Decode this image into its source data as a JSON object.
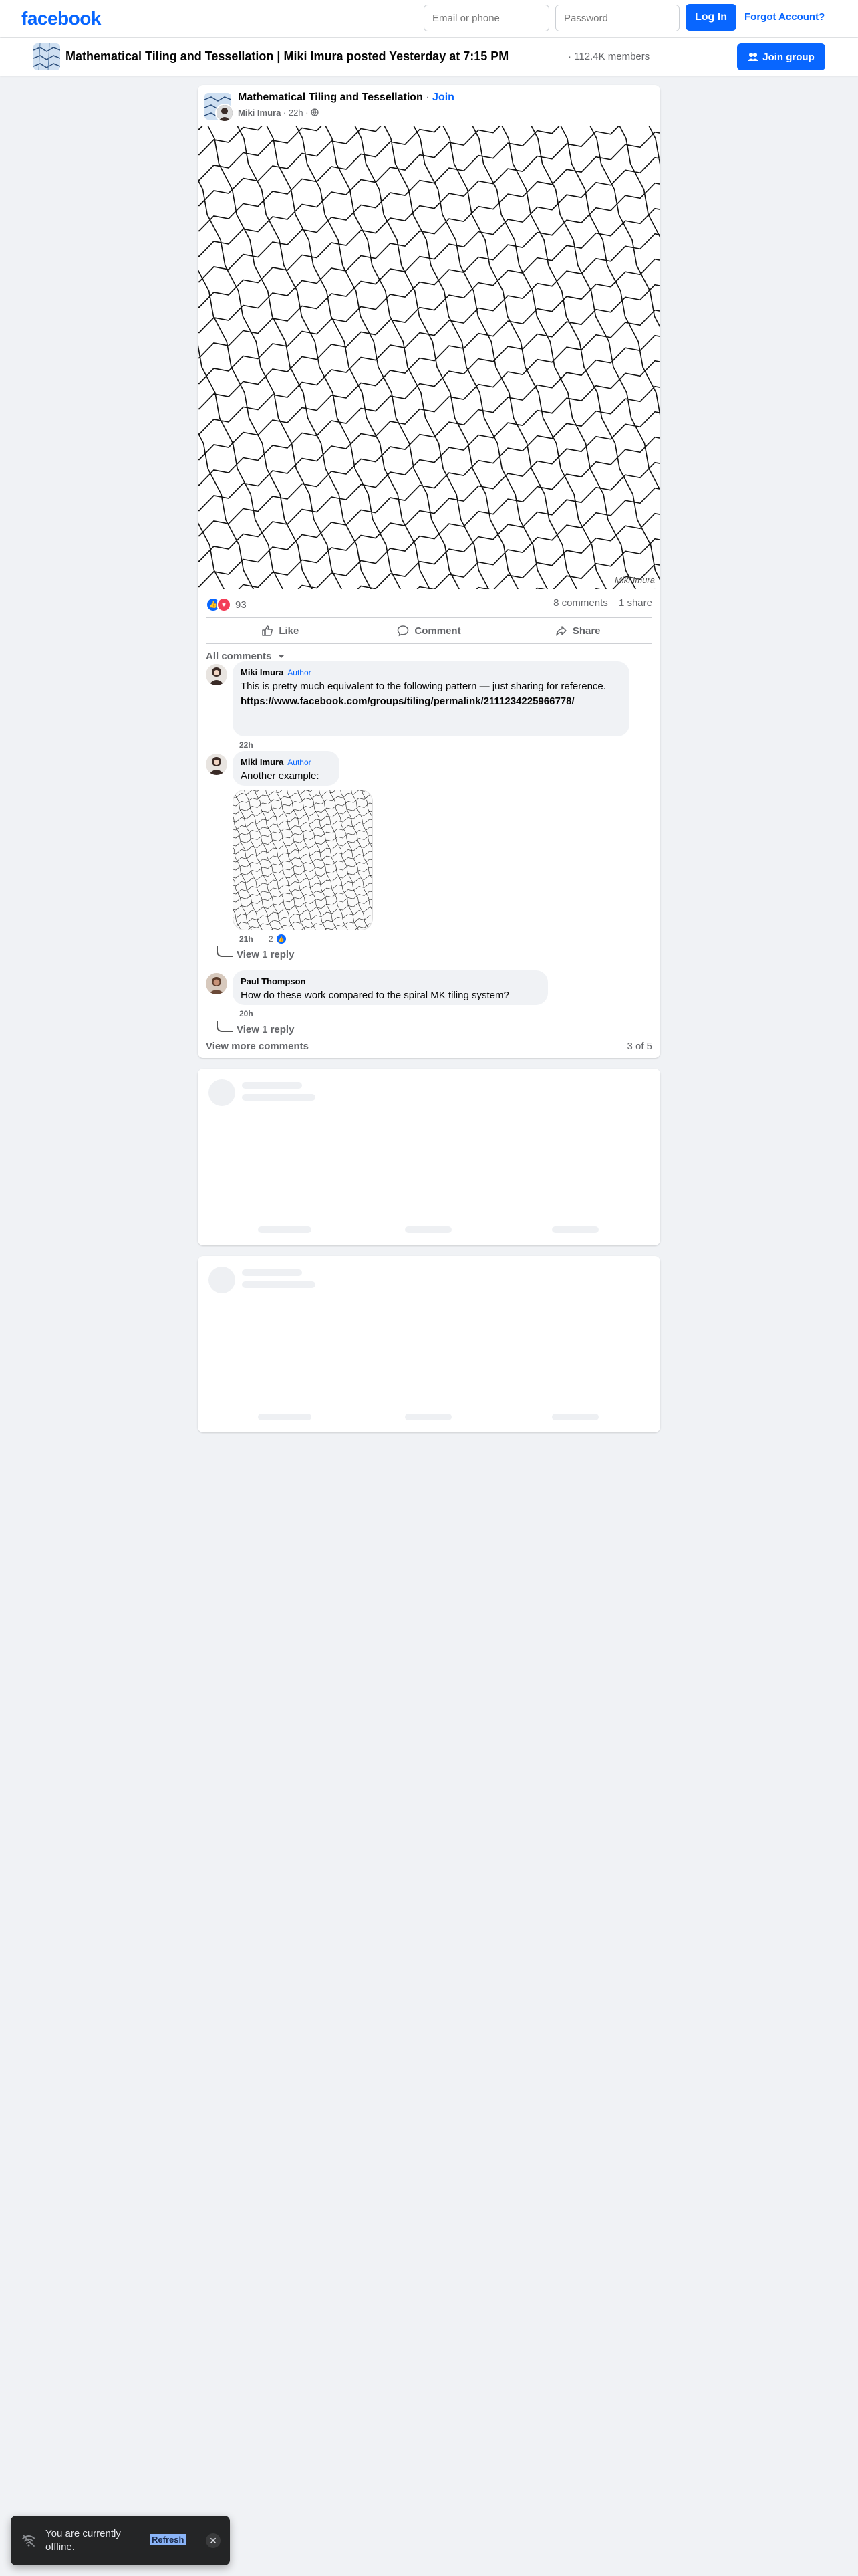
{
  "topbar": {
    "logo": "facebook",
    "email_placeholder": "Email or phone",
    "password_placeholder": "Password",
    "login_label": "Log In",
    "forgot_label": "Forgot Account?"
  },
  "group_header": {
    "title": "Mathematical Tiling and Tessellation | Miki Imura posted Yesterday at 7:15 PM",
    "members": "· 112.4K members",
    "join_label": "Join group"
  },
  "post": {
    "group_name": "Mathematical Tiling and Tessellation",
    "separator": "·",
    "join_label": "Join",
    "author": "Miki Imura",
    "time": "22h",
    "privacy_icon": "globe-icon",
    "image_alt": "zigzag-tessellation-pattern",
    "watermark": "Miki Imura",
    "reaction_count": "93",
    "comments_count": "8 comments",
    "shares_count": "1 share",
    "actions": {
      "like": "Like",
      "comment": "Comment",
      "share": "Share"
    },
    "comment_filter": "All comments"
  },
  "comments": [
    {
      "author": "Miki Imura",
      "badge": "Author",
      "text": "This is pretty much equivalent to the following pattern — just sharing for reference.",
      "link": "https://www.facebook.com/groups/tiling/permalink/2111234225966778/",
      "time": "22h"
    },
    {
      "author": "Miki Imura",
      "badge": "Author",
      "text": "Another example:",
      "time": "21h",
      "reaction_count": "2",
      "replies": "View 1 reply"
    },
    {
      "author": "Paul Thompson",
      "text": "How do these work compared to the spiral MK tiling system?",
      "time": "20h",
      "replies": "View 1 reply"
    }
  ],
  "comments_footer": {
    "view_more": "View more comments",
    "pager": "3 of 5"
  },
  "toast": {
    "text": "You are currently offline.",
    "refresh_label": "Refresh",
    "close_icon": "close-icon"
  },
  "colors": {
    "brand": "#0866ff",
    "background": "#f0f2f5",
    "muted": "#65676b",
    "toast_bg": "#242526"
  }
}
